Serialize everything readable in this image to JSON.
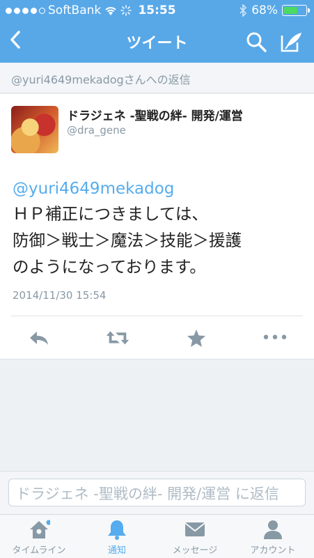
{
  "status_bar": {
    "carrier": "SoftBank",
    "time": "15:55",
    "battery": "68%",
    "battery_level": 0.68
  },
  "nav": {
    "title": "ツイート"
  },
  "reply_context": "@yuri4649mekadogさんへの返信",
  "tweet": {
    "name": "ドラジェネ -聖戦の絆- 開発/運営",
    "handle": "@dra_gene",
    "mention": "@yuri4649mekadog",
    "lines": [
      "ＨＰ補正につきましては、",
      "防御＞戦士＞魔法＞技能＞援護",
      "のようになっております。"
    ],
    "date": "2014/11/30 15:54"
  },
  "actions": {
    "more": "•••"
  },
  "reply_input": {
    "placeholder": "ドラジェネ -聖戦の絆- 開発/運営 に返信"
  },
  "tabs": [
    {
      "label": "タイムライン",
      "icon": "home-icon"
    },
    {
      "label": "通知",
      "icon": "bell-icon"
    },
    {
      "label": "メッセージ",
      "icon": "envelope-icon"
    },
    {
      "label": "アカウント",
      "icon": "person-icon"
    }
  ],
  "colors": {
    "header": "#58a8e8",
    "accent": "#55acee",
    "muted": "#8899a6"
  }
}
